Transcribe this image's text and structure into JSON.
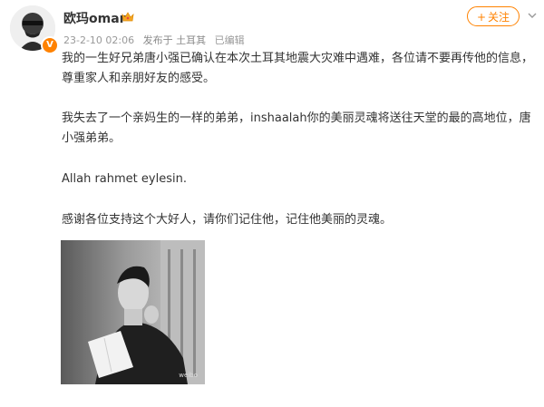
{
  "post": {
    "author": {
      "name": "欧玛omar",
      "verified_badge": "V",
      "avatar_icon": "avatar-portrait",
      "crown_icon": "crown-icon"
    },
    "meta": {
      "timestamp": "23-2-10 02:06",
      "published_from": "发布于 土耳其",
      "edited": "已编辑"
    },
    "follow_label": "关注",
    "follow_plus": "+",
    "paragraphs": [
      "我的一生好兄弟唐小强已确认在本次土耳其地震大灾难中遇难，各位请不要再传他的信息，尊重家人和亲朋好友的感受。",
      "我失去了一个亲妈生的一样的弟弟，inshaalah你的美丽灵魂将送往天堂的最的高地位，唐小强弟弟。",
      "Allah rahmet eylesin.",
      "感谢各位支持这个大好人，请你们记住他，记住他美丽的灵魂。"
    ],
    "image_watermark": "weibo",
    "colors": {
      "accent": "#ff8200",
      "meta": "#999999",
      "text": "#333333"
    }
  }
}
